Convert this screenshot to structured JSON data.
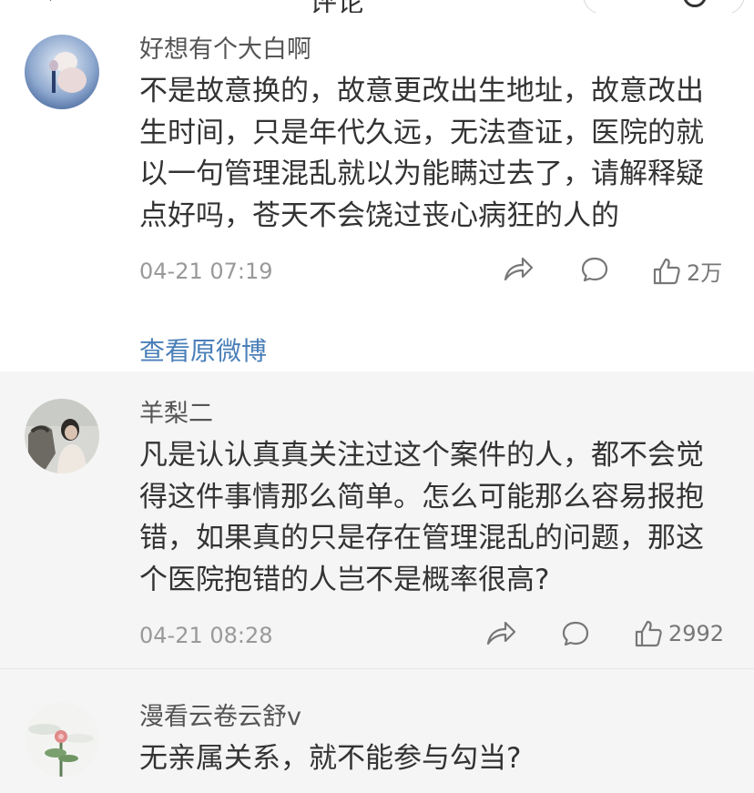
{
  "header": {
    "title": "评论"
  },
  "comments": [
    {
      "username": "好想有个大白啊",
      "text": "不是故意换的，故意更改出生地址，故意改出生时间，只是年代久远，无法查证，医院的就以一句管理混乱就以为能瞒过去了，请解释疑点好吗，苍天不会饶过丧心病狂的人的",
      "time": "04-21 07:19",
      "likes": "2万"
    },
    {
      "username": "羊梨二",
      "text": "凡是认认真真关注过这个案件的人，都不会觉得这件事情那么简单。怎么可能那么容易报抱错，如果真的只是存在管理混乱的问题，那这个医院抱错的人岂不是概率很高?",
      "time": "04-21 08:28",
      "likes": "2992"
    },
    {
      "username": "漫看云卷云舒v",
      "text": "无亲属关系，就不能参与勾当?"
    }
  ],
  "view_original": "查看原微博",
  "icons": [
    "back-icon",
    "close-icon",
    "share-icon",
    "comment-icon",
    "like-icon"
  ],
  "colors": {
    "link": "#4a7fb8",
    "time": "#999999",
    "alt_background": "#f5f5f5"
  }
}
